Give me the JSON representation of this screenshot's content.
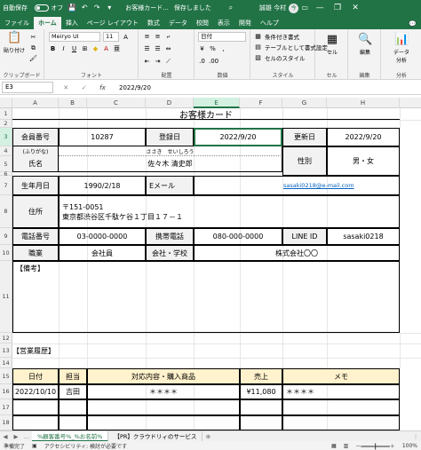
{
  "titlebar": {
    "autosave_label": "自動保存",
    "autosave_state": "オフ",
    "filename": "お客様カード...",
    "save_status": "保存しました",
    "search_icon": "search-icon",
    "user_name": "誠雄 今村",
    "user_initials": "今",
    "minimize": "—",
    "restore": "❐",
    "close": "✕"
  },
  "tabs": [
    "ファイル",
    "ホーム",
    "挿入",
    "ページ レイアウト",
    "数式",
    "データ",
    "校閲",
    "表示",
    "開発",
    "ヘルプ"
  ],
  "active_tab": "ホーム",
  "ribbon": {
    "clipboard": {
      "paste": "貼り付け",
      "label": "クリップボード"
    },
    "font": {
      "name": "Meiryo UI",
      "size": "11",
      "bold": "B",
      "italic": "I",
      "underline": "U",
      "grow": "A",
      "shrink": "A",
      "label": "フォント"
    },
    "alignment": {
      "label": "配置"
    },
    "number": {
      "format": "日付",
      "percent": "%",
      "label": "数値"
    },
    "styles": {
      "conditional": "条件付き書式",
      "table": "テーブルとして書式設定",
      "cell_style": "セルのスタイル",
      "label": "スタイル"
    },
    "cells": {
      "label": "セル",
      "button": "セル"
    },
    "editing": {
      "label": "編集",
      "button": "編集"
    },
    "analysis": {
      "label": "分析",
      "button": "データ\n分析"
    }
  },
  "formula_bar": {
    "name_box": "E3",
    "cancel": "✕",
    "enter": "✓",
    "fx": "fx",
    "value": "2022/9/20"
  },
  "columns": [
    "A",
    "B",
    "C",
    "D",
    "E",
    "F",
    "G",
    "H"
  ],
  "rows": [
    "1",
    "2",
    "3",
    "4",
    "5",
    "6",
    "7",
    "8",
    "9",
    "10",
    "11",
    "12",
    "13",
    "14",
    "15",
    "16",
    "17",
    "18"
  ],
  "selected_cell": {
    "column": "E",
    "row": "3"
  },
  "card": {
    "title": "お客様カード",
    "member_no_label": "会員番号",
    "member_no": "10287",
    "registered_label": "登録日",
    "registered": "2022/9/20",
    "updated_label": "更新日",
    "updated": "2022/9/20",
    "furigana_label": "(ふりがな)",
    "furigana": "ささき　せいしろう",
    "name_label": "氏名",
    "name": "佐々木 清史郎",
    "gender_label": "性別",
    "gender": "男・女",
    "dob_label": "生年月日",
    "dob": "1990/2/18",
    "email_label": "Eメール",
    "email": "sasaki0218@e-mail.com",
    "address_label": "住所",
    "postal": "〒151-0051",
    "address": "東京都渋谷区千駄ケ谷１丁目１７－１",
    "phone_label": "電話番号",
    "phone": "03-0000-0000",
    "mobile_label": "携帯電話",
    "mobile": "080-000-0000",
    "line_label": "LINE ID",
    "line": "sasaki0218",
    "job_label": "職業",
    "job": "会社員",
    "company_label": "会社・学校",
    "company": "株式会社〇〇",
    "notes_label": "【備考】",
    "history_label": "【営業履歴】",
    "history_headers": [
      "日付",
      "担当",
      "対応内容・購入商品",
      "売上",
      "メモ"
    ],
    "history_rows": [
      [
        "2022/10/10",
        "吉田",
        "＊＊＊＊",
        "¥11,080",
        "＊＊＊＊"
      ]
    ]
  },
  "sheet_tabs": [
    "%顧客番号%_%お名前%",
    "【PR】クラウドリィのサービス"
  ],
  "active_sheet": "%顧客番号%_%お名前%",
  "statusbar": {
    "ready": "準備完了",
    "accessibility": "アクセシビリティ: 検討が必要です",
    "zoom": "100%"
  }
}
